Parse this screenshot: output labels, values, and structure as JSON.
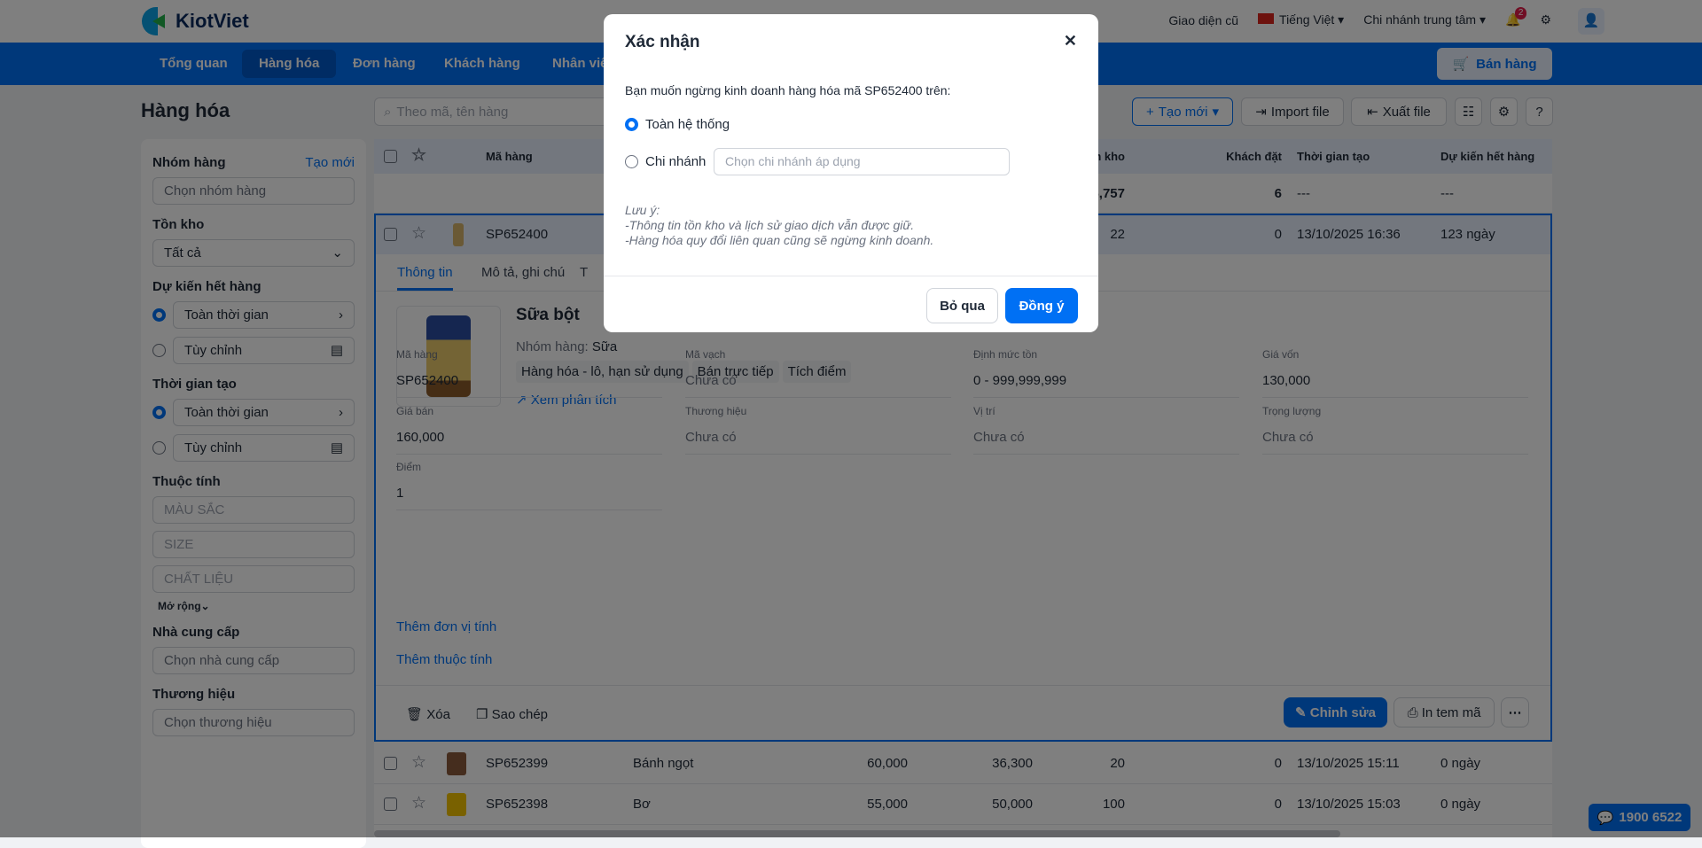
{
  "header": {
    "logo": "KiotViet",
    "old_ui": "Giao diện cũ",
    "language": "Tiếng Việt",
    "branch": "Chi nhánh trung tâm",
    "notif_count": "2"
  },
  "nav": {
    "items": [
      "Tổng quan",
      "Hàng hóa",
      "Đơn hàng",
      "Khách hàng",
      "Nhân viên"
    ],
    "sell": "Bán hàng"
  },
  "page": {
    "title": "Hàng hóa",
    "search_placeholder": "Theo mã, tên hàng",
    "create": "Tạo mới",
    "import": "Import file",
    "export": "Xuất file"
  },
  "sidebar": {
    "group": "Nhóm hàng",
    "group_create": "Tạo mới",
    "group_ph": "Chọn nhóm hàng",
    "stock": "Tồn kho",
    "stock_val": "Tất cả",
    "expected": "Dự kiến hết hàng",
    "all_time": "Toàn thời gian",
    "custom": "Tùy chỉnh",
    "created": "Thời gian tạo",
    "attrs": "Thuộc tính",
    "attr_list": [
      "MÀU SẮC",
      "SIZE",
      "CHẤT LIỆU"
    ],
    "expand": "Mở rộng",
    "supplier": "Nhà cung cấp",
    "supplier_ph": "Chọn nhà cung cấp",
    "brand": "Thương hiệu",
    "brand_ph": "Chọn thương hiệu"
  },
  "table": {
    "headers": {
      "code": "Mã hàng",
      "stock": "Tồn kho",
      "ordered": "Khách đặt",
      "created": "Thời gian tạo",
      "expected": "Dự kiến hết hàng"
    },
    "summary": {
      "stock": "6,757",
      "ordered": "6",
      "created": "---",
      "expected": "---"
    },
    "expanded": {
      "code": "SP652400",
      "stock": "22",
      "ordered": "0",
      "created": "13/10/2025 16:36",
      "expected": "123 ngày",
      "tabs": [
        "Thông tin",
        "Mô tả, ghi chú",
        "T"
      ],
      "name": "Sữa bột",
      "group_label": "Nhóm hàng:",
      "group": "Sữa",
      "tags": [
        "Hàng hóa - lô, hạn sử dụng",
        "Bán trực tiếp",
        "Tích điểm"
      ],
      "analysis": "Xem phân tích",
      "fields": [
        {
          "l": "Mã hàng",
          "v": "SP652400"
        },
        {
          "l": "Mã vạch",
          "v": "Chưa có"
        },
        {
          "l": "Định mức tồn",
          "v": "0 - 999,999,999"
        },
        {
          "l": "Giá vốn",
          "v": "130,000"
        },
        {
          "l": "Giá bán",
          "v": "160,000"
        },
        {
          "l": "Thương hiệu",
          "v": "Chưa có"
        },
        {
          "l": "Vị trí",
          "v": "Chưa có"
        },
        {
          "l": "Trọng lượng",
          "v": "Chưa có"
        },
        {
          "l": "Điểm",
          "v": "1"
        }
      ],
      "add_unit": "Thêm đơn vị tính",
      "add_attr": "Thêm thuộc tính",
      "delete": "Xóa",
      "copy": "Sao chép",
      "edit": "Chỉnh sửa",
      "print": "In tem mã"
    },
    "rows": [
      {
        "code": "SP652399",
        "name": "Bánh ngọt",
        "price": "60,000",
        "cost": "36,300",
        "stock": "20",
        "ordered": "0",
        "created": "13/10/2025 15:11",
        "expected": "0 ngày"
      },
      {
        "code": "SP652398",
        "name": "Bơ",
        "price": "55,000",
        "cost": "50,000",
        "stock": "100",
        "ordered": "0",
        "created": "13/10/2025 15:03",
        "expected": "0 ngày"
      }
    ]
  },
  "modal": {
    "title": "Xác nhận",
    "question": "Bạn muốn ngừng kinh doanh hàng hóa mã SP652400 trên:",
    "opt_all": "Toàn hệ thống",
    "opt_branch": "Chi nhánh",
    "branch_ph": "Chọn chi nhánh áp dụng",
    "note_title": "Lưu ý:",
    "note1": "-Thông tin tồn kho và lịch sử giao dịch vẫn được giữ.",
    "note2": "-Hàng hóa quy đổi liên quan cũng sẽ ngừng kinh doanh.",
    "cancel": "Bỏ qua",
    "ok": "Đồng ý"
  },
  "hotline": "1900 6522"
}
